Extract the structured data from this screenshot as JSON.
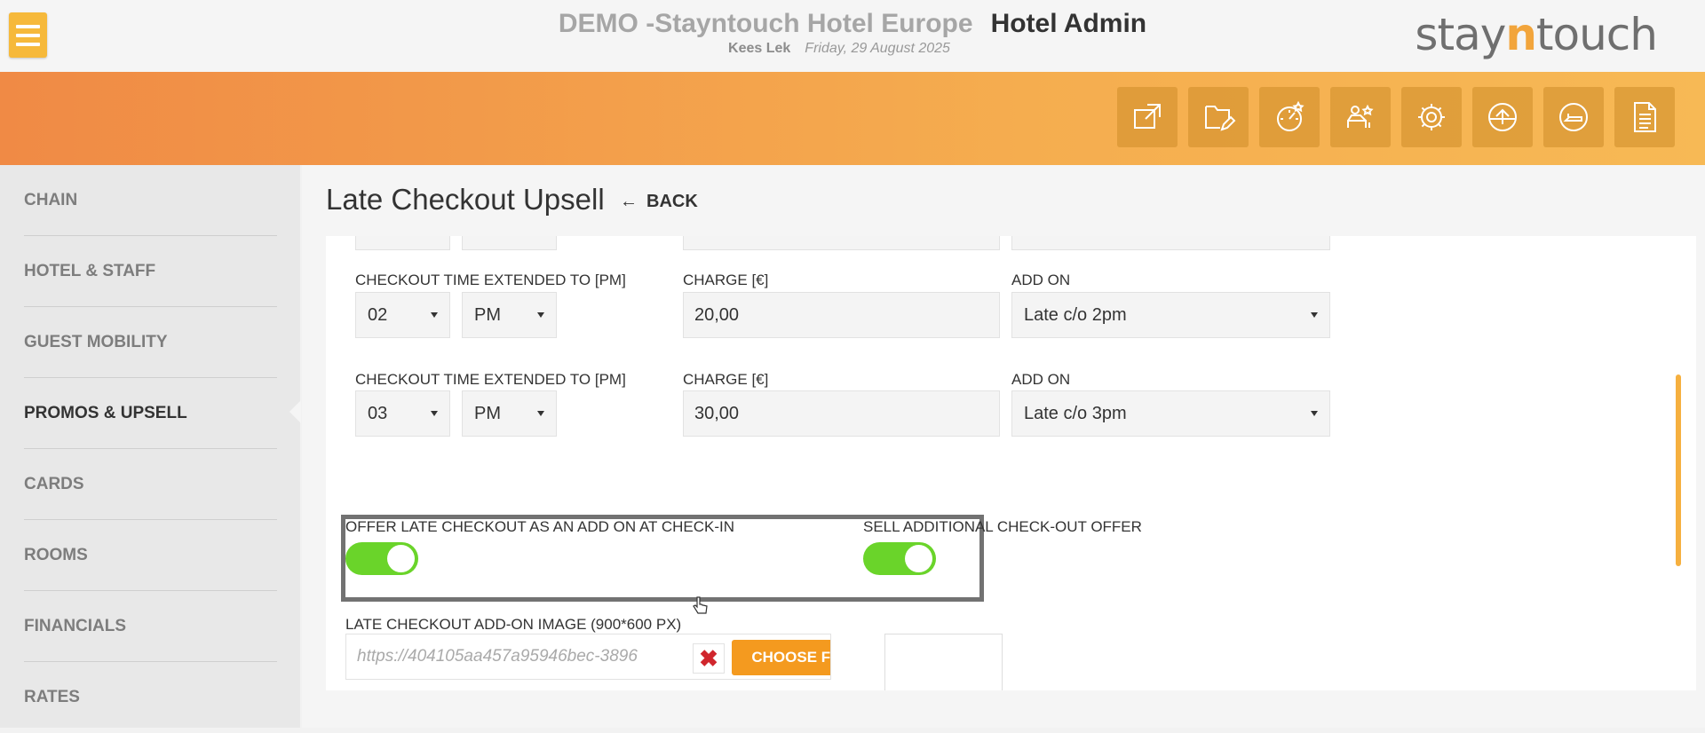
{
  "header": {
    "hotel_name": "DEMO -Stayntouch Hotel Europe",
    "section_title": "Hotel Admin",
    "user_name": "Kees Lek",
    "date": "Friday, 29 August 2025",
    "logo": {
      "before": "stay",
      "accent": "n",
      "after": "touch",
      "accent_color": "#f2a53c"
    },
    "menu_icon": "hamburger-menu-icon"
  },
  "toolbar_icons": [
    "external-link-icon",
    "folder-edit-icon",
    "speedometer-star-icon",
    "guest-star-icon",
    "gear-icon",
    "upload-circle-icon",
    "room-key-icon",
    "document-icon"
  ],
  "sidebar": {
    "items": [
      {
        "label": "CHAIN",
        "active": false
      },
      {
        "label": "HOTEL & STAFF",
        "active": false
      },
      {
        "label": "GUEST MOBILITY",
        "active": false
      },
      {
        "label": "PROMOS & UPSELL",
        "active": true
      },
      {
        "label": "CARDS",
        "active": false
      },
      {
        "label": "ROOMS",
        "active": false
      },
      {
        "label": "FINANCIALS",
        "active": false
      },
      {
        "label": "RATES",
        "active": false
      }
    ]
  },
  "page": {
    "title": "Late Checkout Upsell",
    "back_label": "BACK"
  },
  "rows": [
    {
      "time_label": "CHECKOUT TIME EXTENDED TO [PM]",
      "hour": "02",
      "meridiem": "PM",
      "charge_label": "CHARGE [€]",
      "charge": "20,00",
      "addon_label": "ADD ON",
      "addon": "Late c/o 2pm"
    },
    {
      "time_label": "CHECKOUT TIME EXTENDED TO [PM]",
      "hour": "03",
      "meridiem": "PM",
      "charge_label": "CHARGE [€]",
      "charge": "30,00",
      "addon_label": "ADD ON",
      "addon": "Late c/o 3pm"
    }
  ],
  "toggles": {
    "offer_addon_label": "OFFER LATE CHECKOUT AS AN ADD ON AT CHECK-IN",
    "offer_addon_on": true,
    "sell_offer_label": "SELL ADDITIONAL CHECK-OUT OFFER",
    "sell_offer_on": true,
    "on_color": "#6ad42a"
  },
  "image_upload": {
    "label": "LATE CHECKOUT ADD-ON IMAGE (900*600 PX)",
    "value": "https://404105aa457a95946bec-3896",
    "choose_label": "CHOOSE FILE",
    "delete_icon": "red-x-icon"
  },
  "colors": {
    "accent": "#f49a1f",
    "banner_start": "#f08a45",
    "banner_end": "#f7b955"
  }
}
